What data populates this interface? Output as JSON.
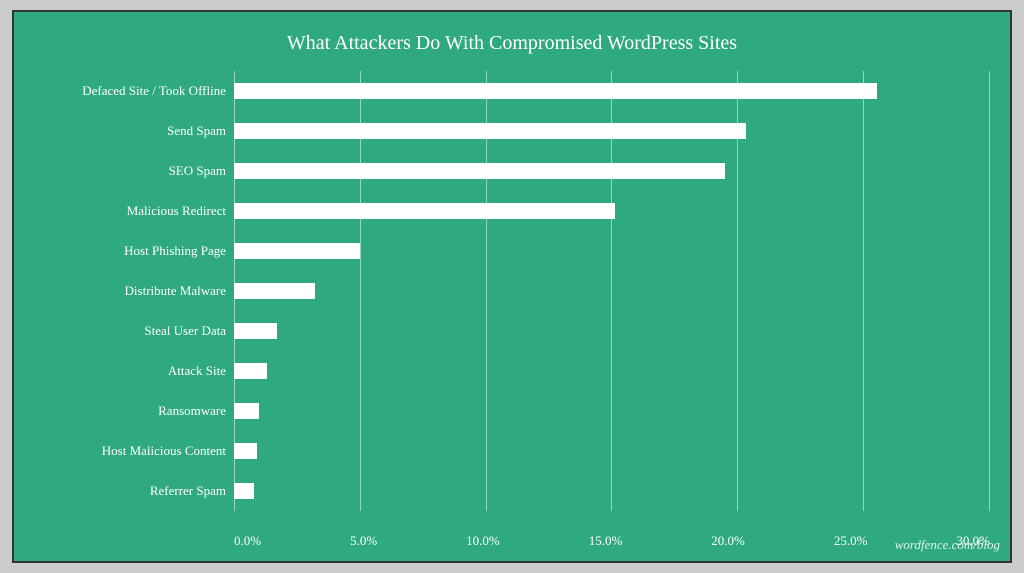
{
  "chart": {
    "title": "What Attackers Do With Compromised WordPress Sites",
    "watermark": "wordfence.com/blog",
    "bars": [
      {
        "label": "Defaced Site / Took Offline",
        "value": 25.5
      },
      {
        "label": "Send Spam",
        "value": 20.3
      },
      {
        "label": "SEO Spam",
        "value": 19.5
      },
      {
        "label": "Malicious Redirect",
        "value": 15.1
      },
      {
        "label": "Host Phishing Page",
        "value": 5.0
      },
      {
        "label": "Distribute Malware",
        "value": 3.2
      },
      {
        "label": "Steal User Data",
        "value": 1.7
      },
      {
        "label": "Attack Site",
        "value": 1.3
      },
      {
        "label": "Ransomware",
        "value": 1.0
      },
      {
        "label": "Host Malicious Content",
        "value": 0.9
      },
      {
        "label": "Referrer Spam",
        "value": 0.8
      }
    ],
    "x_ticks": [
      "0.0%",
      "5.0%",
      "10.0%",
      "15.0%",
      "20.0%",
      "25.0%",
      "30.0%"
    ],
    "max_value": 30
  }
}
